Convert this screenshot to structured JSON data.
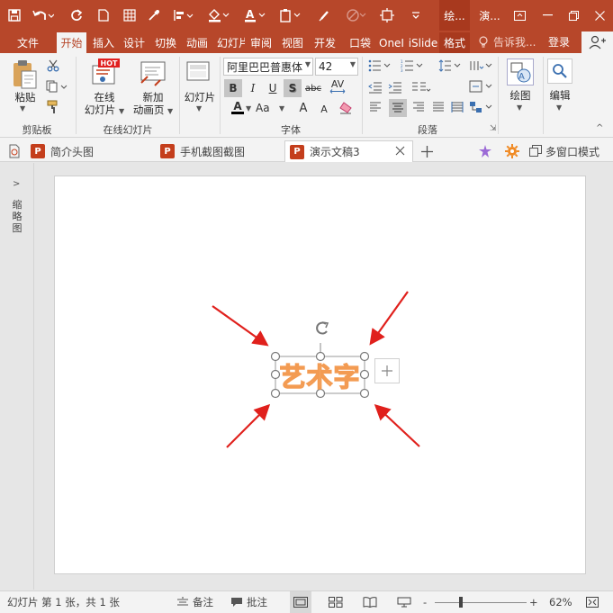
{
  "window": {
    "context_tab_draw": "绘...",
    "context_tab_app": "演...",
    "colors": {
      "accent": "#b7472a",
      "accent_dark": "#a8391e",
      "ribbon_bg": "#f3f3f3",
      "wordart": "#f39b52",
      "arrow": "#e0201c"
    }
  },
  "tabs": [
    {
      "label": "文件"
    },
    {
      "label": "开始"
    },
    {
      "label": "插入"
    },
    {
      "label": "设计"
    },
    {
      "label": "切换"
    },
    {
      "label": "动画"
    },
    {
      "label": "幻灯片"
    },
    {
      "label": "审阅"
    },
    {
      "label": "视图"
    },
    {
      "label": "开发"
    },
    {
      "label": "口袋"
    },
    {
      "label": "OneI"
    },
    {
      "label": "iSlide"
    },
    {
      "label": "格式"
    }
  ],
  "tell_me": "告诉我...",
  "sign_in": "登录",
  "ribbon": {
    "clipboard": {
      "paste": "粘贴",
      "group": "剪贴板"
    },
    "online": {
      "hot_badge": "HOT",
      "online_slides_l1": "在线",
      "online_slides_l2": "幻灯片",
      "new_anim_l1": "新加",
      "new_anim_l2": "动画页",
      "group": "在线幻灯片"
    },
    "slides": {
      "label": "幻灯片"
    },
    "font": {
      "name": "阿里巴巴普惠体",
      "size": "42",
      "bold": "B",
      "italic": "I",
      "underline": "U",
      "shadow": "S",
      "strike": "abc",
      "spacing": "AV",
      "color_a": "A",
      "case": "Aa",
      "grow": "A",
      "shrink": "A",
      "group": "字体"
    },
    "paragraph": {
      "group": "段落"
    },
    "drawing": {
      "label": "绘图"
    },
    "editing": {
      "label": "编辑"
    }
  },
  "doc_tabs": [
    {
      "title": "简介头图"
    },
    {
      "title": "手机截图截图"
    },
    {
      "title": "演示文稿3"
    }
  ],
  "doc_tab_icon": "P",
  "multi_window": "多窗口模式",
  "left_pane_label": "缩略图",
  "slide": {
    "wordart_text": "艺术字"
  },
  "status": {
    "slide_info": "幻灯片 第 1 张，共 1 张",
    "notes": "备注",
    "comments": "批注",
    "zoom_minus": "-",
    "zoom_plus": "+",
    "zoom_level": "62%"
  }
}
